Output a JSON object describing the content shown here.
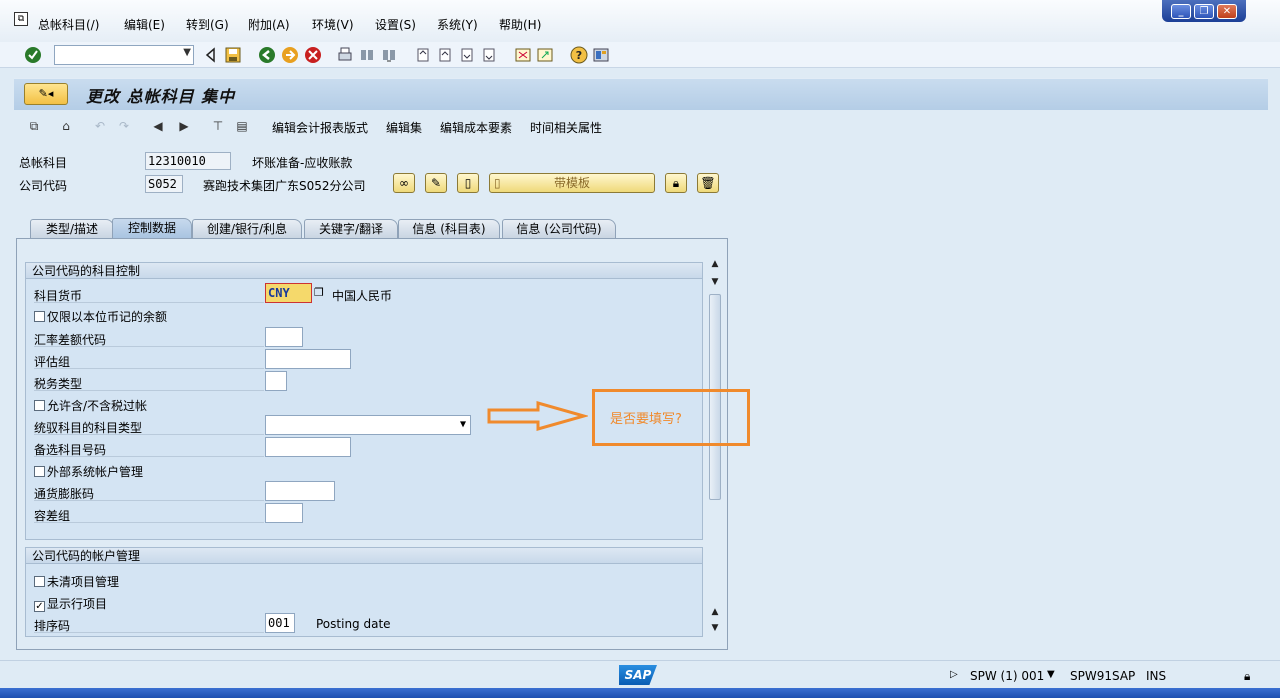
{
  "menubar": {
    "items": [
      "总帐科目(/)",
      "编辑(E)",
      "转到(G)",
      "附加(A)",
      "环境(V)",
      "设置(S)",
      "系统(Y)",
      "帮助(H)"
    ]
  },
  "window_controls": [
    "_",
    "❐",
    "✕"
  ],
  "title": {
    "button_icon": "pencil-glasses-icon",
    "text": "更改 总帐科目 集中"
  },
  "app_toolbar": {
    "texts": [
      "编辑会计报表版式",
      "编辑集",
      "编辑成本要素",
      "时间相关属性"
    ]
  },
  "header": {
    "gl_account_label": "总帐科目",
    "gl_account_value": "12310010",
    "gl_account_desc": "坏账准备-应收账款",
    "company_code_label": "公司代码",
    "company_code_value": "S052",
    "company_code_desc": "赛跑技术集团广东S052分公司",
    "template_button": "带模板"
  },
  "tabs": [
    "类型/描述",
    "控制数据",
    "创建/银行/利息",
    "关键字/翻译",
    "信息 (科目表)",
    "信息 (公司代码)"
  ],
  "active_tab": "控制数据",
  "group1": {
    "title": "公司代码的科目控制",
    "account_currency_label": "科目货币",
    "account_currency_value": "CNY",
    "account_currency_desc": "中国人民币",
    "only_local_currency": "仅限以本位币记的余额",
    "exchange_diff_label": "汇率差额代码",
    "valuation_group_label": "评估组",
    "tax_category_label": "税务类型",
    "allow_tax_posting": "允许含/不含税过帐",
    "recon_account_label": "统驭科目的科目类型",
    "alt_account_label": "备选科目号码",
    "external_mgmt": "外部系统帐户管理",
    "inflation_key_label": "通货膨胀码",
    "tolerance_group_label": "容差组"
  },
  "group2": {
    "title": "公司代码的帐户管理",
    "open_item_mgmt": "未清项目管理",
    "line_item_display": "显示行项目",
    "sort_key_label": "排序码",
    "sort_key_value": "001",
    "sort_key_desc": "Posting date"
  },
  "annotation": {
    "text": "是否要填写?",
    "color": "#f08a2c"
  },
  "statusbar": {
    "system": "SPW (1) 001",
    "server": "SPW91SAP",
    "mode": "INS",
    "logo": "SAP"
  }
}
